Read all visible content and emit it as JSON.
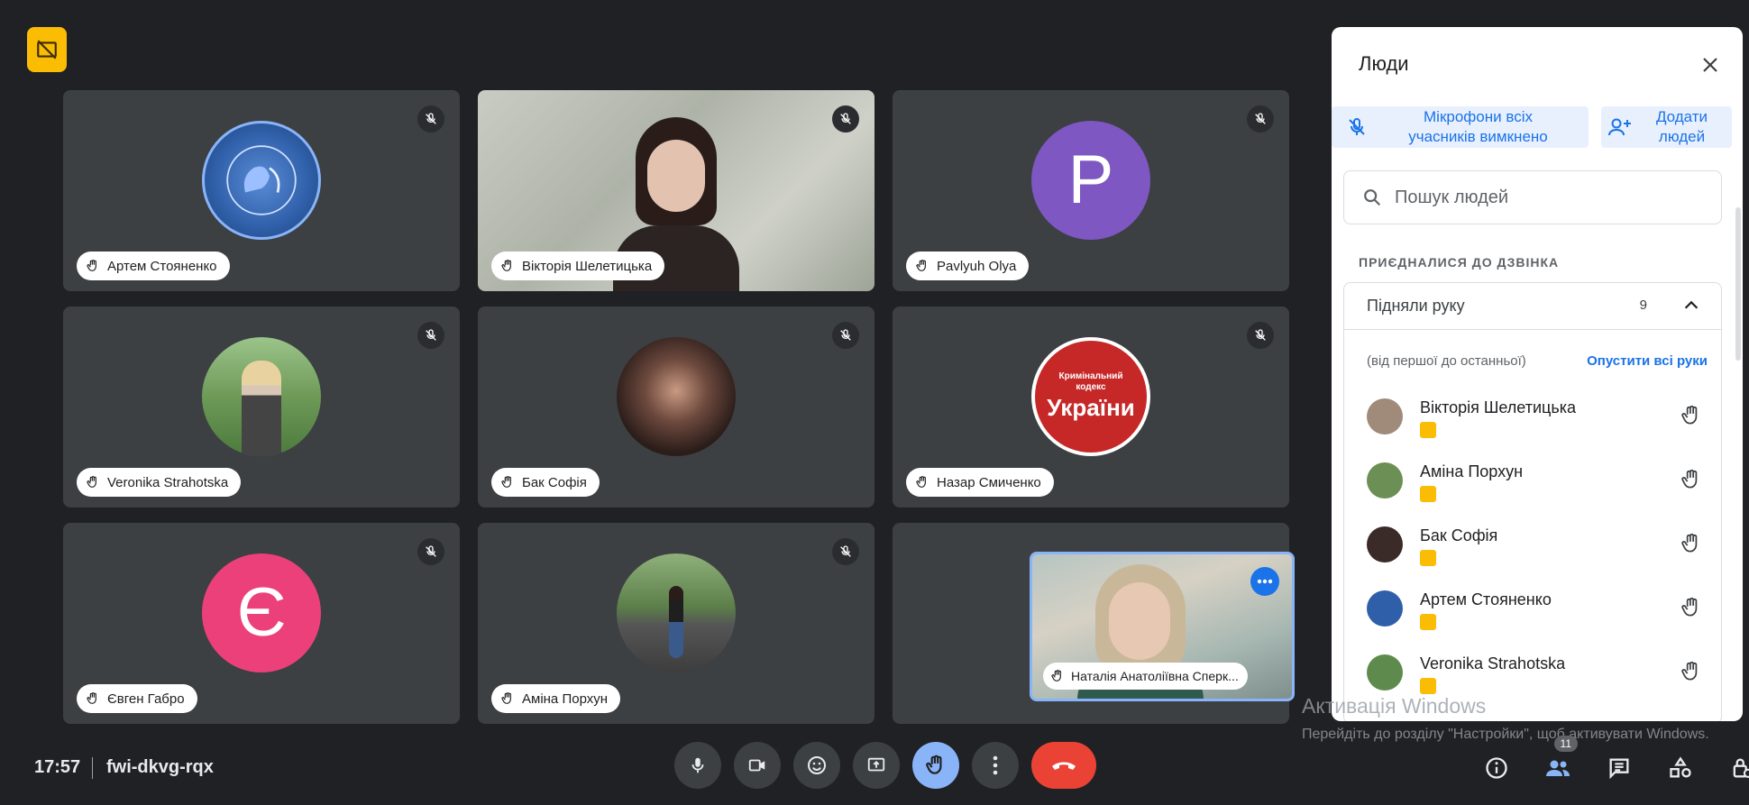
{
  "colors": {
    "bg": "#202124",
    "tile": "#3c4043",
    "accent": "#1a73e8",
    "hand_active": "#8ab4f8",
    "end_call": "#ea4335",
    "badge_yellow": "#fbbc04"
  },
  "tiles": [
    {
      "name": "Артем Стояненко",
      "avatar_type": "image",
      "avatar_bg": "#2f5fa8"
    },
    {
      "name": "Вікторія Шелетицька",
      "avatar_type": "video",
      "avatar_bg": "#b9bfb6"
    },
    {
      "name": "Pavlyuh Olya",
      "avatar_type": "letter",
      "letter": "P",
      "avatar_bg": "#7e57c2"
    },
    {
      "name": "Veronika Strahotska",
      "avatar_type": "image",
      "avatar_bg": "#5f8a4e"
    },
    {
      "name": "Бак Софія",
      "avatar_type": "image",
      "avatar_bg": "#3a2a28"
    },
    {
      "name": "Назар Смиченко",
      "avatar_type": "image",
      "avatar_bg": "#c62828",
      "avatar_text_1": "Кримінальний",
      "avatar_text_2": "кодекс",
      "avatar_text_3": "України"
    },
    {
      "name": "Євген Габро",
      "avatar_type": "letter",
      "letter": "Є",
      "avatar_bg": "#ec407a"
    },
    {
      "name": "Аміна Порхун",
      "avatar_type": "image",
      "avatar_bg": "#6b8f54"
    }
  ],
  "floating": {
    "name": "Наталія Анатоліївна Сперк..."
  },
  "panel": {
    "title": "Люди",
    "mute_all_label_1": "Мікрофони всіх",
    "mute_all_label_2": "учасників вимкнено",
    "add_people_label_1": "Додати",
    "add_people_label_2": "людей",
    "search_placeholder": "Пошук людей",
    "section_title": "ПРИЄДНАЛИСЯ ДО ДЗВІНКА",
    "group_title": "Підняли руку",
    "group_count": "9",
    "order_note": "(від першої до останньої)",
    "lower_all": "Опустити всі руки",
    "people": [
      {
        "name": "Вікторія Шелетицька",
        "color": "#a08a7a"
      },
      {
        "name": "Аміна Порхун",
        "color": "#6b8f54"
      },
      {
        "name": "Бак Софія",
        "color": "#3a2a28"
      },
      {
        "name": "Артем Стояненко",
        "color": "#2f5fa8"
      },
      {
        "name": "Veronika Strahotska",
        "color": "#5f8a4e"
      }
    ]
  },
  "windows_activation": {
    "title": "Активація Windows",
    "text": "Перейдіть до розділу \"Настройки\", щоб активувати Windows."
  },
  "bottom": {
    "time": "17:57",
    "meeting_code": "fwi-dkvg-rqx",
    "participants_count": "11",
    "icons": [
      "mic-icon",
      "camera-icon",
      "emoji-icon",
      "present-icon",
      "raise-hand-icon",
      "more-icon",
      "end-call-icon"
    ],
    "right_icons": [
      "info-icon",
      "people-icon",
      "chat-icon",
      "activities-icon",
      "host-controls-icon"
    ]
  }
}
